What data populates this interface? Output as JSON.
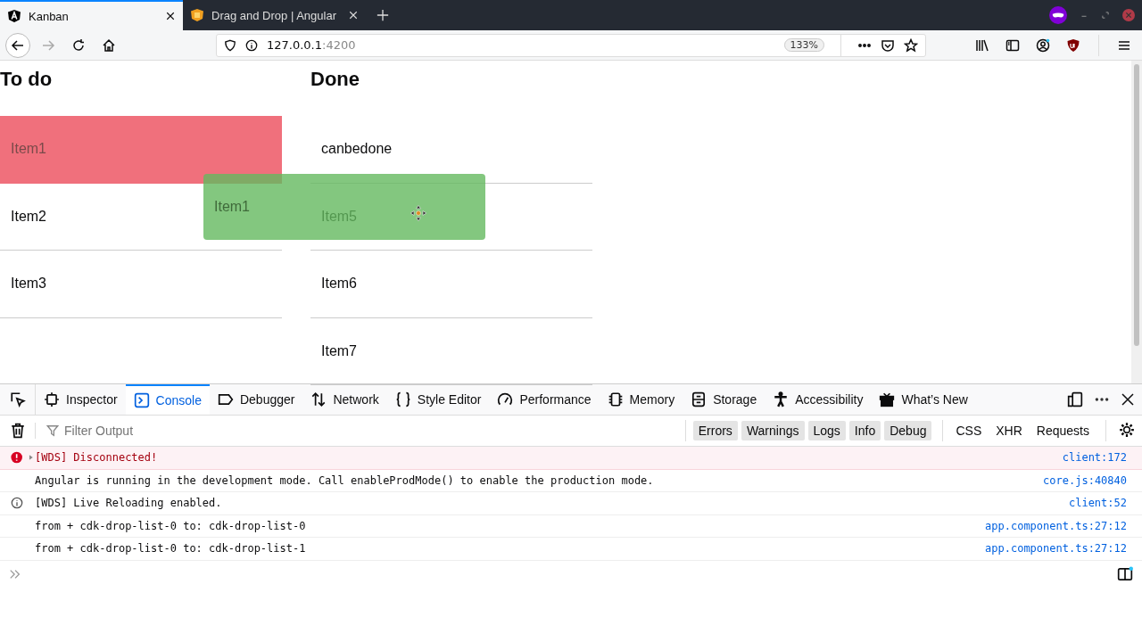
{
  "browser": {
    "tabs": [
      {
        "label": "Kanban",
        "selected": true
      },
      {
        "label": "Drag and Drop | Angular",
        "selected": false
      }
    ],
    "url": {
      "host": "127.0.0.1",
      "port": ":4200"
    },
    "zoom": "133%"
  },
  "page": {
    "lists": [
      {
        "title": "To do",
        "items": [
          {
            "label": "Item1",
            "kind": "placeholder"
          },
          {
            "label": "Item2",
            "kind": "item"
          },
          {
            "label": "Item3",
            "kind": "item"
          }
        ]
      },
      {
        "title": "Done",
        "items": [
          {
            "label": "canbedone",
            "kind": "item"
          },
          {
            "label": "Item5",
            "kind": "item"
          },
          {
            "label": "Item6",
            "kind": "item"
          },
          {
            "label": "Item7",
            "kind": "item"
          }
        ]
      }
    ],
    "drag_preview": {
      "label": "Item1"
    }
  },
  "devtools": {
    "tabs": [
      {
        "label": "Inspector",
        "selected": false
      },
      {
        "label": "Console",
        "selected": true
      },
      {
        "label": "Debugger",
        "selected": false
      },
      {
        "label": "Network",
        "selected": false
      },
      {
        "label": "Style Editor",
        "selected": false
      },
      {
        "label": "Performance",
        "selected": false
      },
      {
        "label": "Memory",
        "selected": false
      },
      {
        "label": "Storage",
        "selected": false
      },
      {
        "label": "Accessibility",
        "selected": false
      },
      {
        "label": "What’s New",
        "selected": false
      }
    ],
    "filter": {
      "placeholder": "Filter Output"
    },
    "levels": [
      {
        "label": "Errors",
        "on": true
      },
      {
        "label": "Warnings",
        "on": true
      },
      {
        "label": "Logs",
        "on": true
      },
      {
        "label": "Info",
        "on": true
      },
      {
        "label": "Debug",
        "on": true
      }
    ],
    "types": [
      {
        "label": "CSS",
        "on": false
      },
      {
        "label": "XHR",
        "on": false
      },
      {
        "label": "Requests",
        "on": false
      }
    ],
    "messages": [
      {
        "kind": "error",
        "text": "[WDS] Disconnected!",
        "source": "client:172"
      },
      {
        "kind": "log",
        "text": "Angular is running in the development mode. Call enableProdMode() to enable the production mode.",
        "source": "core.js:40840"
      },
      {
        "kind": "info",
        "text": "[WDS] Live Reloading enabled.",
        "source": "client:52"
      },
      {
        "kind": "log",
        "text": "from + cdk-drop-list-0 to: cdk-drop-list-0",
        "source": "app.component.ts:27:12"
      },
      {
        "kind": "log",
        "text": "from + cdk-drop-list-0 to: cdk-drop-list-1",
        "source": "app.component.ts:27:12"
      }
    ]
  }
}
